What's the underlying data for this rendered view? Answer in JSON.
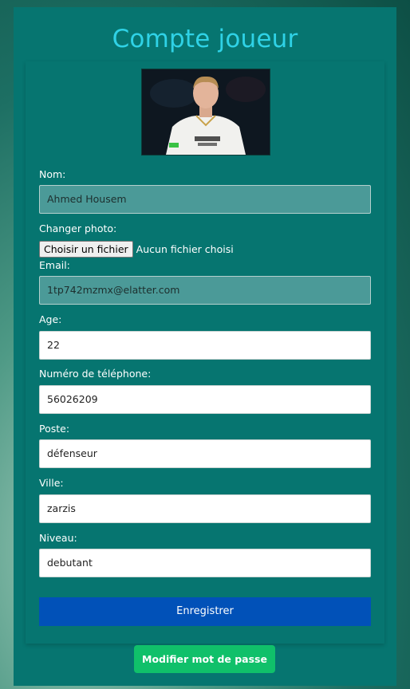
{
  "page": {
    "title": "Compte joueur"
  },
  "photo": {
    "alt_icon": "player-photo"
  },
  "form": {
    "nom_label": "Nom:",
    "nom_value": "Ahmed Housem",
    "photo_label": "Changer photo:",
    "file_button_label": "Choisir un fichier",
    "file_status": "Aucun fichier choisi",
    "email_label": "Email:",
    "email_value": "1tp742mzmx@elatter.com",
    "age_label": "Age:",
    "age_value": "22",
    "phone_label": "Numéro de téléphone:",
    "phone_value": "56026209",
    "poste_label": "Poste:",
    "poste_value": "défenseur",
    "ville_label": "Ville:",
    "ville_value": "zarzis",
    "niveau_label": "Niveau:",
    "niveau_value": "debutant",
    "save_label": "Enregistrer",
    "password_label": "Modifier mot de passe"
  },
  "colors": {
    "panel": "#067570",
    "title": "#2fd2e6",
    "save_button": "#0151b8",
    "password_button": "#10c06a"
  }
}
